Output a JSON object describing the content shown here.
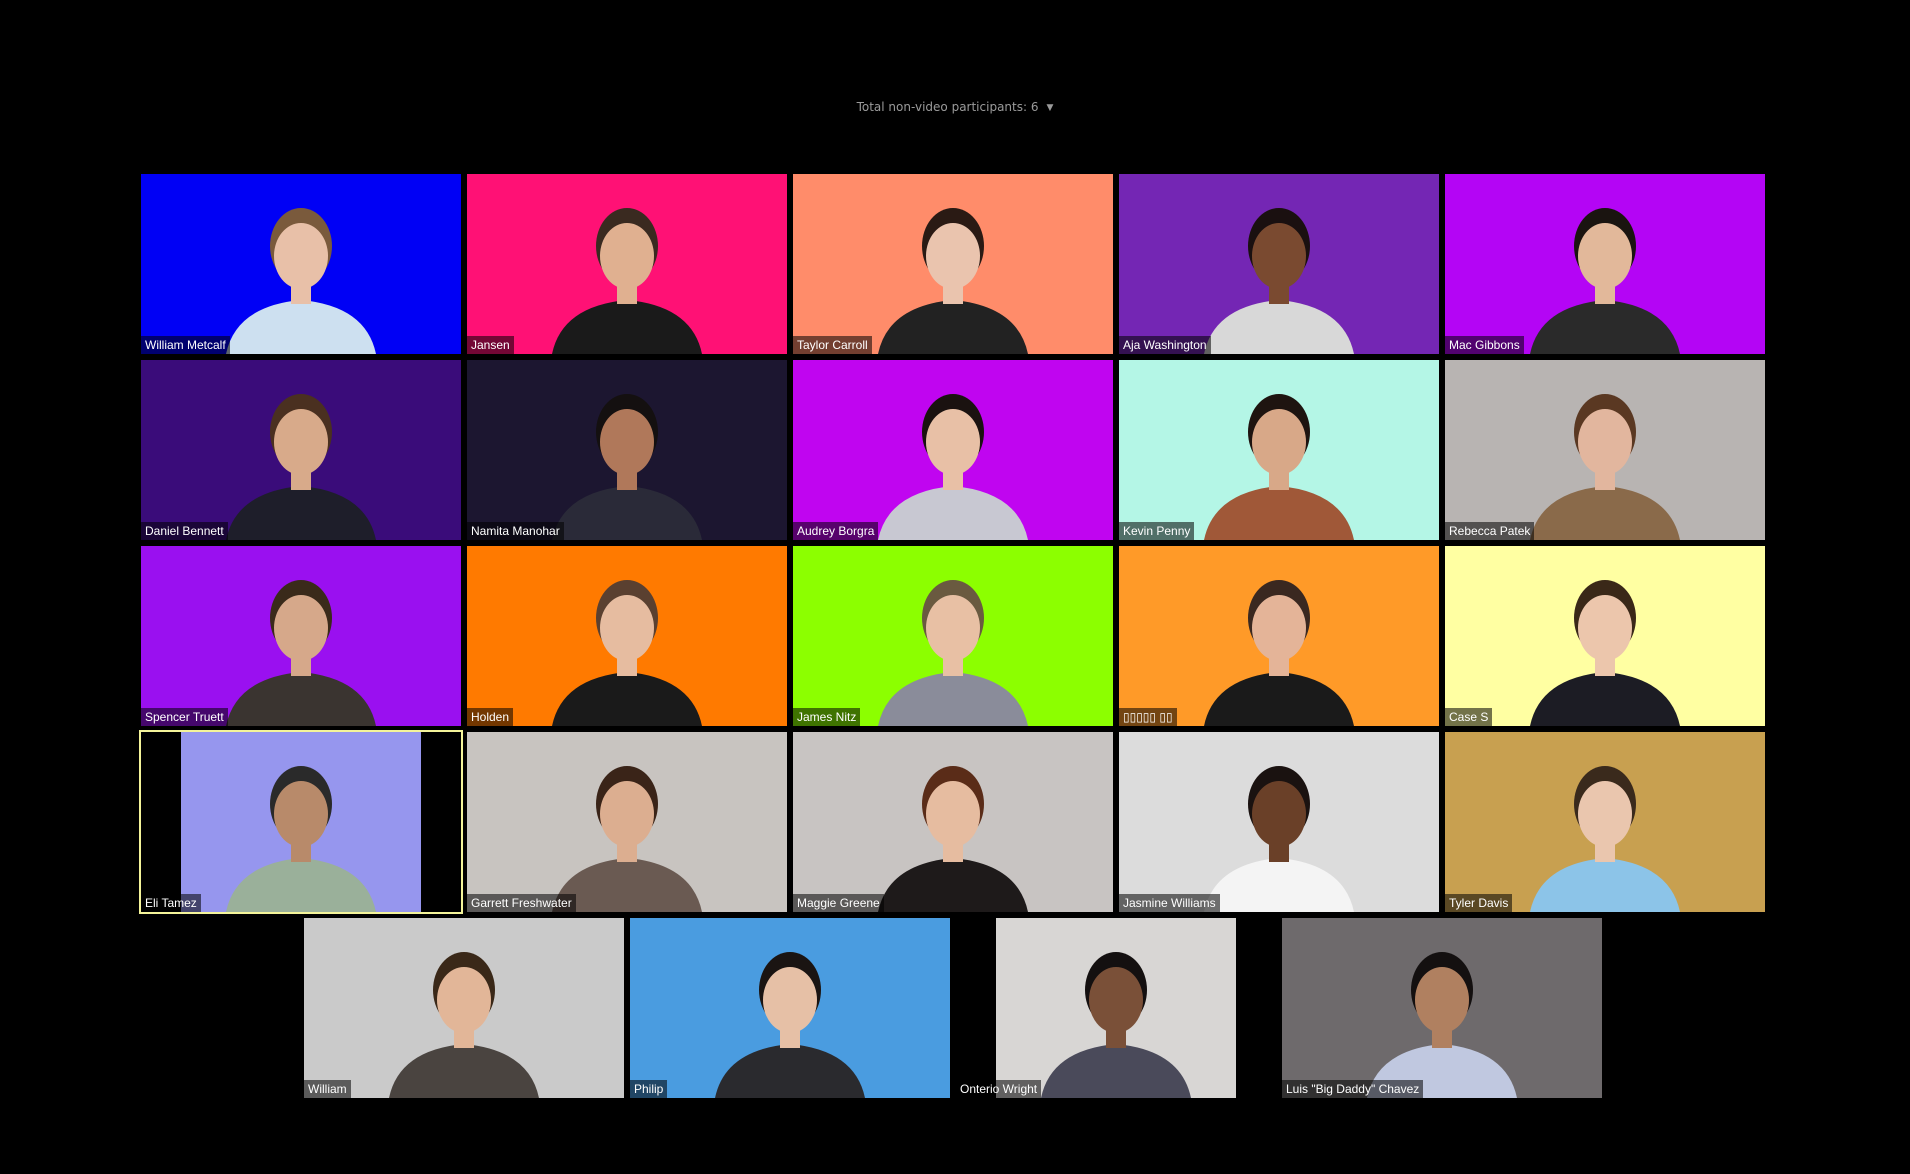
{
  "header": {
    "nonvideo_label": "Total non-video participants: 6"
  },
  "participants": [
    {
      "name": "William Metcalf",
      "bg": "#0000f5",
      "shirt": "#cde0f0",
      "hair": "#7a5a3c",
      "skin": "#e8c0a8"
    },
    {
      "name": "Jansen",
      "bg": "#ff1175",
      "shirt": "#1a1a1a",
      "hair": "#3a2a20",
      "skin": "#e0b090"
    },
    {
      "name": "Taylor Carroll",
      "bg": "#ff8c6a",
      "shirt": "#222222",
      "hair": "#2a1a14",
      "skin": "#eac4ae"
    },
    {
      "name": "Aja Washington",
      "bg": "#7426b4",
      "shirt": "#d8d8d8",
      "hair": "#1a1010",
      "skin": "#7a4a30"
    },
    {
      "name": "Mac Gibbons",
      "bg": "#b405f5",
      "shirt": "#2a2a2a",
      "hair": "#1a1410",
      "skin": "#e2b89a"
    },
    {
      "name": "Daniel Bennett",
      "bg": "#3a0c7a",
      "shirt": "#1e1e2a",
      "hair": "#4a3020",
      "skin": "#d8aa8a"
    },
    {
      "name": "Namita Manohar",
      "bg": "#1c1630",
      "shirt": "#2a2a38",
      "hair": "#141010",
      "skin": "#b0785a"
    },
    {
      "name": "Audrey Borgra",
      "bg": "#c005f0",
      "shirt": "#c8c8d2",
      "hair": "#1a1210",
      "skin": "#e8c0a6"
    },
    {
      "name": "Kevin Penny",
      "bg": "#b4f6e6",
      "shirt": "#a05838",
      "hair": "#1e1410",
      "skin": "#d8a888"
    },
    {
      "name": "Rebecca Patek",
      "bg": "#b8b4b2",
      "shirt": "#8a6a4a",
      "hair": "#5a3822",
      "skin": "#e2b69e"
    },
    {
      "name": "Spencer Truett",
      "bg": "#9a10f0",
      "shirt": "#3a3430",
      "hair": "#3a2a1a",
      "skin": "#d6a88a"
    },
    {
      "name": "Holden",
      "bg": "#ff7a00",
      "shirt": "#1a1a1a",
      "hair": "#5a4030",
      "skin": "#e6bca0"
    },
    {
      "name": "James Nitz",
      "bg": "#8cff00",
      "shirt": "#8a8c9a",
      "hair": "#6a5a40",
      "skin": "#e8c0a4"
    },
    {
      "name": "▯▯▯▯▯ ▯▯",
      "bg": "#ff9a28",
      "shirt": "#1a1a1a",
      "hair": "#3a2820",
      "skin": "#e4b498"
    },
    {
      "name": "Case S",
      "bg": "#ffffa2",
      "shirt": "#1c1c24",
      "hair": "#3a2818",
      "skin": "#ecc6ac"
    },
    {
      "name": "Eli Tamez",
      "bg": "#9696ee",
      "shirt": "#9ab09a",
      "hair": "#2a2a2a",
      "skin": "#b88a6a"
    },
    {
      "name": "Garrett Freshwater",
      "bg": "#c8c4c0",
      "shirt": "#6a5a52",
      "hair": "#3a2418",
      "skin": "#dcae90"
    },
    {
      "name": "Maggie Greene",
      "bg": "#c8c4c2",
      "shirt": "#1e1a1a",
      "hair": "#5a2c18",
      "skin": "#e6bca0"
    },
    {
      "name": "Jasmine Williams",
      "bg": "#dcdcdc",
      "shirt": "#f4f4f4",
      "hair": "#1a1210",
      "skin": "#6a4028"
    },
    {
      "name": "Tyler Davis",
      "bg": "#c8a050",
      "shirt": "#8cc4e8",
      "hair": "#3a2a1c",
      "skin": "#eac6ae"
    },
    {
      "name": "William",
      "bg": "#cacaca",
      "shirt": "#4a4440",
      "hair": "#3a2818",
      "skin": "#e2b698"
    },
    {
      "name": "Philip",
      "bg": "#4a9ce0",
      "shirt": "#2a2a2e",
      "hair": "#1a1412",
      "skin": "#e6c0a6"
    },
    {
      "name": "Onterio Wright",
      "bg": "#d8d6d4",
      "shirt": "#4a4a5a",
      "hair": "#141010",
      "skin": "#7a5038"
    },
    {
      "name": "Luis \"Big Daddy\" Chavez",
      "bg": "#6e6a6c",
      "shirt": "#c0c8e0",
      "hair": "#141010",
      "skin": "#b08060"
    }
  ]
}
